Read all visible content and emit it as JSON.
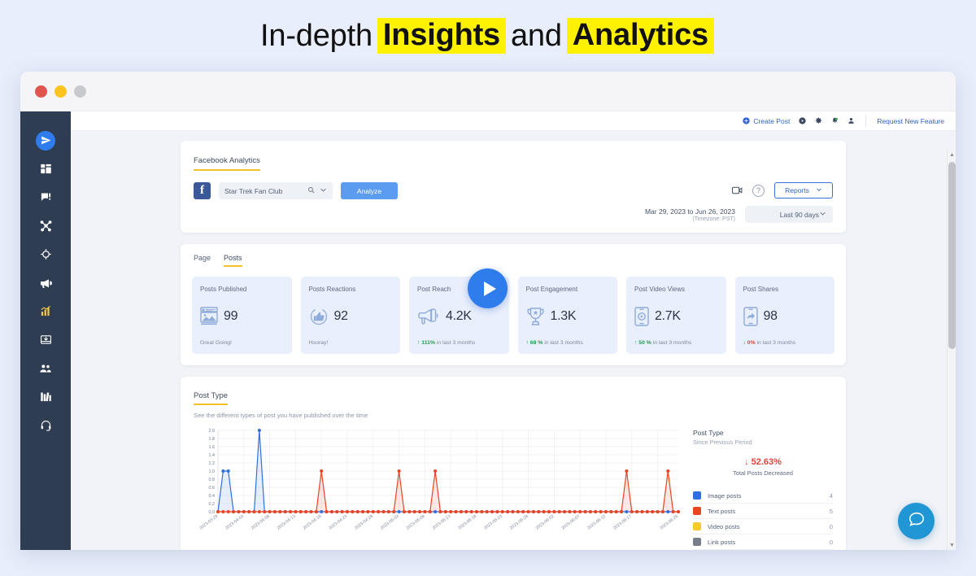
{
  "headline": {
    "part1": "In-depth",
    "highlight1": "Insights",
    "part2": "and",
    "highlight2": "Analytics"
  },
  "window": {
    "dots": [
      "close",
      "minimize",
      "maximize"
    ]
  },
  "sidebar": {
    "items": [
      {
        "icon": "paper-plane-icon",
        "name": "publish"
      },
      {
        "icon": "dashboard-grid-icon",
        "name": "dashboard"
      },
      {
        "icon": "chat-comment-icon",
        "name": "engage"
      },
      {
        "icon": "share-network-icon",
        "name": "collaborate"
      },
      {
        "icon": "target-icon",
        "name": "monitor"
      },
      {
        "icon": "megaphone-icon",
        "name": "campaigns"
      },
      {
        "icon": "bar-chart-icon",
        "name": "analytics"
      },
      {
        "icon": "inbox-download-icon",
        "name": "inbox"
      },
      {
        "icon": "users-icon",
        "name": "audience"
      },
      {
        "icon": "library-icon",
        "name": "library"
      },
      {
        "icon": "headset-icon",
        "name": "support"
      }
    ]
  },
  "topbar": {
    "create_post": "Create Post",
    "icons": [
      "plus-circle-icon",
      "play-circle-icon",
      "gear-icon",
      "bell-icon",
      "user-icon"
    ],
    "request_feature": "Request New Feature"
  },
  "analytics_header": {
    "tab_title": "Facebook Analytics",
    "account_icon": "facebook-icon",
    "account_name": "Star Trek Fan Club",
    "search_icon": "search-icon",
    "chevron_icon": "chevron-down-icon",
    "analyze_button": "Analyze",
    "video_icon": "video-camera-icon",
    "help_icon": "question-mark-icon",
    "reports_button": "Reports",
    "date_range": "Mar 29, 2023 to Jun 26, 2023",
    "timezone": "(Timezone: PST)",
    "period_select": "Last 90 days"
  },
  "stats": {
    "tabs": [
      {
        "label": "Page",
        "active": false
      },
      {
        "label": "Posts",
        "active": true
      }
    ],
    "cards": [
      {
        "title": "Posts Published",
        "value": "99",
        "icon": "image-post-icon",
        "footer_text": "Great Going!",
        "footer_type": "note"
      },
      {
        "title": "Posts Reactions",
        "value": "92",
        "icon": "thumbs-up-icon",
        "footer_text": "Hooray!",
        "footer_type": "note"
      },
      {
        "title": "Post Reach",
        "value": "4.2K",
        "icon": "megaphone-icon",
        "footer_arrow": "↑",
        "footer_pct": "111%",
        "footer_note": "in last 3 months",
        "footer_type": "up"
      },
      {
        "title": "Post Engagement",
        "value": "1.3K",
        "icon": "trophy-icon",
        "footer_arrow": "↑",
        "footer_pct": "68 %",
        "footer_note": "in last 3 months",
        "footer_type": "up"
      },
      {
        "title": "Post Video Views",
        "value": "2.7K",
        "icon": "mobile-video-icon",
        "footer_arrow": "↑",
        "footer_pct": "50 %",
        "footer_note": "in last 3 months",
        "footer_type": "up"
      },
      {
        "title": "Post Shares",
        "value": "98",
        "icon": "mobile-share-icon",
        "footer_arrow": "↓",
        "footer_pct": "0%",
        "footer_note": "in last 3 months",
        "footer_type": "down"
      }
    ]
  },
  "post_type_section": {
    "title": "Post Type",
    "subtitle": "See the different types of post you have published over the time",
    "summary_title": "Post Type",
    "summary_sub": "Since Previous Period",
    "delta": "↓ 52.63%",
    "delta_label": "Total Posts Decreased",
    "legend": [
      {
        "label": "Image posts",
        "value": "4",
        "color": "#2f6fe0"
      },
      {
        "label": "Text posts",
        "value": "5",
        "color": "#ea4424"
      },
      {
        "label": "Video posts",
        "value": "0",
        "color": "#f7cb2e"
      },
      {
        "label": "Link posts",
        "value": "0",
        "color": "#787f8b"
      }
    ]
  },
  "chart_data": {
    "type": "line",
    "title": "Post Type",
    "subtitle": "See the different types of post you have published over the time",
    "xlabel": "",
    "ylabel": "",
    "ylim": [
      0,
      2
    ],
    "yticks": [
      "0.0",
      "0.2",
      "0.4",
      "0.6",
      "0.8",
      "1.0",
      "1.2",
      "1.4",
      "1.6",
      "1.8",
      "2.0"
    ],
    "grid": true,
    "legend_position": "right",
    "x": [
      "2023-03-29",
      "2023-03-30",
      "2023-03-31",
      "2023-04-01",
      "2023-04-02",
      "2023-04-03",
      "2023-04-04",
      "2023-04-05",
      "2023-04-06",
      "2023-04-07",
      "2023-04-08",
      "2023-04-09",
      "2023-04-10",
      "2023-04-11",
      "2023-04-12",
      "2023-04-13",
      "2023-04-14",
      "2023-04-15",
      "2023-04-16",
      "2023-04-17",
      "2023-04-18",
      "2023-04-19",
      "2023-04-20",
      "2023-04-21",
      "2023-04-22",
      "2023-04-23",
      "2023-04-24",
      "2023-04-25",
      "2023-04-26",
      "2023-04-27",
      "2023-04-28",
      "2023-04-29",
      "2023-04-30",
      "2023-05-01",
      "2023-05-02",
      "2023-05-03",
      "2023-05-04",
      "2023-05-05",
      "2023-05-06",
      "2023-05-07",
      "2023-05-08",
      "2023-05-09",
      "2023-05-10",
      "2023-05-11",
      "2023-05-12",
      "2023-05-13",
      "2023-05-14",
      "2023-05-15",
      "2023-05-16",
      "2023-05-17",
      "2023-05-18",
      "2023-05-19",
      "2023-05-20",
      "2023-05-21",
      "2023-05-22",
      "2023-05-23",
      "2023-05-24",
      "2023-05-25",
      "2023-05-26",
      "2023-05-27",
      "2023-05-28",
      "2023-05-29",
      "2023-05-30",
      "2023-05-31",
      "2023-06-01",
      "2023-06-02",
      "2023-06-03",
      "2023-06-04",
      "2023-06-05",
      "2023-06-06",
      "2023-06-07",
      "2023-06-08",
      "2023-06-09",
      "2023-06-10",
      "2023-06-11",
      "2023-06-12",
      "2023-06-13",
      "2023-06-14",
      "2023-06-15",
      "2023-06-16",
      "2023-06-17",
      "2023-06-18",
      "2023-06-19",
      "2023-06-20",
      "2023-06-21",
      "2023-06-22",
      "2023-06-23",
      "2023-06-24",
      "2023-06-25",
      "2023-06-26"
    ],
    "xtick_labels": [
      "2023-03-29",
      "2023-04-03",
      "2023-04-08",
      "2023-04-13",
      "2023-04-18",
      "2023-04-23",
      "2023-04-28",
      "2023-05-03",
      "2023-05-08",
      "2023-05-13",
      "2023-05-18",
      "2023-05-23",
      "2023-05-28",
      "2023-06-02",
      "2023-06-07",
      "2023-06-12",
      "2023-06-17",
      "2023-06-26"
    ],
    "series": [
      {
        "name": "Image posts",
        "color": "#2f6fe0",
        "values": [
          0,
          1,
          1,
          0,
          0,
          0,
          0,
          0,
          2,
          0,
          0,
          0,
          0,
          0,
          0,
          0,
          0,
          0,
          0,
          0,
          0,
          0,
          0,
          0,
          0,
          0,
          0,
          0,
          0,
          0,
          0,
          0,
          0,
          0,
          0,
          0,
          0,
          0,
          0,
          0,
          0,
          0,
          0,
          0,
          0,
          0,
          0,
          0,
          0,
          0,
          0,
          0,
          0,
          0,
          0,
          0,
          0,
          0,
          0,
          0,
          0,
          0,
          0,
          0,
          0,
          0,
          0,
          0,
          0,
          0,
          0,
          0,
          0,
          0,
          0,
          0,
          0,
          0,
          0,
          0,
          0,
          0,
          0,
          0,
          0,
          0,
          0,
          0,
          0,
          0
        ]
      },
      {
        "name": "Text posts",
        "color": "#ea4424",
        "values": [
          0,
          0,
          0,
          0,
          0,
          0,
          0,
          0,
          0,
          0,
          0,
          0,
          0,
          0,
          0,
          0,
          0,
          0,
          0,
          0,
          1,
          0,
          0,
          0,
          0,
          0,
          0,
          0,
          0,
          0,
          0,
          0,
          0,
          0,
          0,
          1,
          0,
          0,
          0,
          0,
          0,
          0,
          1,
          0,
          0,
          0,
          0,
          0,
          0,
          0,
          0,
          0,
          0,
          0,
          0,
          0,
          0,
          0,
          0,
          0,
          0,
          0,
          0,
          0,
          0,
          0,
          0,
          0,
          0,
          0,
          0,
          0,
          0,
          0,
          0,
          0,
          0,
          0,
          0,
          1,
          0,
          0,
          0,
          0,
          0,
          0,
          0,
          1,
          0,
          0
        ]
      }
    ]
  }
}
